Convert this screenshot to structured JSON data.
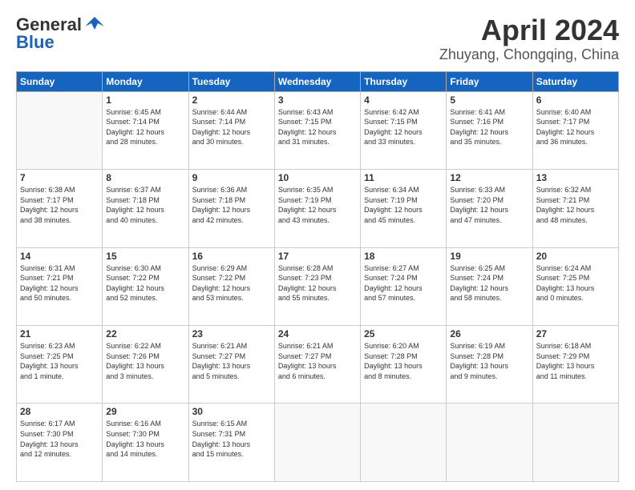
{
  "header": {
    "logo_general": "General",
    "logo_blue": "Blue",
    "title": "April 2024",
    "subtitle": "Zhuyang, Chongqing, China"
  },
  "calendar": {
    "days_of_week": [
      "Sunday",
      "Monday",
      "Tuesday",
      "Wednesday",
      "Thursday",
      "Friday",
      "Saturday"
    ],
    "weeks": [
      [
        {
          "num": "",
          "info": ""
        },
        {
          "num": "1",
          "info": "Sunrise: 6:45 AM\nSunset: 7:14 PM\nDaylight: 12 hours\nand 28 minutes."
        },
        {
          "num": "2",
          "info": "Sunrise: 6:44 AM\nSunset: 7:14 PM\nDaylight: 12 hours\nand 30 minutes."
        },
        {
          "num": "3",
          "info": "Sunrise: 6:43 AM\nSunset: 7:15 PM\nDaylight: 12 hours\nand 31 minutes."
        },
        {
          "num": "4",
          "info": "Sunrise: 6:42 AM\nSunset: 7:15 PM\nDaylight: 12 hours\nand 33 minutes."
        },
        {
          "num": "5",
          "info": "Sunrise: 6:41 AM\nSunset: 7:16 PM\nDaylight: 12 hours\nand 35 minutes."
        },
        {
          "num": "6",
          "info": "Sunrise: 6:40 AM\nSunset: 7:17 PM\nDaylight: 12 hours\nand 36 minutes."
        }
      ],
      [
        {
          "num": "7",
          "info": "Sunrise: 6:38 AM\nSunset: 7:17 PM\nDaylight: 12 hours\nand 38 minutes."
        },
        {
          "num": "8",
          "info": "Sunrise: 6:37 AM\nSunset: 7:18 PM\nDaylight: 12 hours\nand 40 minutes."
        },
        {
          "num": "9",
          "info": "Sunrise: 6:36 AM\nSunset: 7:18 PM\nDaylight: 12 hours\nand 42 minutes."
        },
        {
          "num": "10",
          "info": "Sunrise: 6:35 AM\nSunset: 7:19 PM\nDaylight: 12 hours\nand 43 minutes."
        },
        {
          "num": "11",
          "info": "Sunrise: 6:34 AM\nSunset: 7:19 PM\nDaylight: 12 hours\nand 45 minutes."
        },
        {
          "num": "12",
          "info": "Sunrise: 6:33 AM\nSunset: 7:20 PM\nDaylight: 12 hours\nand 47 minutes."
        },
        {
          "num": "13",
          "info": "Sunrise: 6:32 AM\nSunset: 7:21 PM\nDaylight: 12 hours\nand 48 minutes."
        }
      ],
      [
        {
          "num": "14",
          "info": "Sunrise: 6:31 AM\nSunset: 7:21 PM\nDaylight: 12 hours\nand 50 minutes."
        },
        {
          "num": "15",
          "info": "Sunrise: 6:30 AM\nSunset: 7:22 PM\nDaylight: 12 hours\nand 52 minutes."
        },
        {
          "num": "16",
          "info": "Sunrise: 6:29 AM\nSunset: 7:22 PM\nDaylight: 12 hours\nand 53 minutes."
        },
        {
          "num": "17",
          "info": "Sunrise: 6:28 AM\nSunset: 7:23 PM\nDaylight: 12 hours\nand 55 minutes."
        },
        {
          "num": "18",
          "info": "Sunrise: 6:27 AM\nSunset: 7:24 PM\nDaylight: 12 hours\nand 57 minutes."
        },
        {
          "num": "19",
          "info": "Sunrise: 6:25 AM\nSunset: 7:24 PM\nDaylight: 12 hours\nand 58 minutes."
        },
        {
          "num": "20",
          "info": "Sunrise: 6:24 AM\nSunset: 7:25 PM\nDaylight: 13 hours\nand 0 minutes."
        }
      ],
      [
        {
          "num": "21",
          "info": "Sunrise: 6:23 AM\nSunset: 7:25 PM\nDaylight: 13 hours\nand 1 minute."
        },
        {
          "num": "22",
          "info": "Sunrise: 6:22 AM\nSunset: 7:26 PM\nDaylight: 13 hours\nand 3 minutes."
        },
        {
          "num": "23",
          "info": "Sunrise: 6:21 AM\nSunset: 7:27 PM\nDaylight: 13 hours\nand 5 minutes."
        },
        {
          "num": "24",
          "info": "Sunrise: 6:21 AM\nSunset: 7:27 PM\nDaylight: 13 hours\nand 6 minutes."
        },
        {
          "num": "25",
          "info": "Sunrise: 6:20 AM\nSunset: 7:28 PM\nDaylight: 13 hours\nand 8 minutes."
        },
        {
          "num": "26",
          "info": "Sunrise: 6:19 AM\nSunset: 7:28 PM\nDaylight: 13 hours\nand 9 minutes."
        },
        {
          "num": "27",
          "info": "Sunrise: 6:18 AM\nSunset: 7:29 PM\nDaylight: 13 hours\nand 11 minutes."
        }
      ],
      [
        {
          "num": "28",
          "info": "Sunrise: 6:17 AM\nSunset: 7:30 PM\nDaylight: 13 hours\nand 12 minutes."
        },
        {
          "num": "29",
          "info": "Sunrise: 6:16 AM\nSunset: 7:30 PM\nDaylight: 13 hours\nand 14 minutes."
        },
        {
          "num": "30",
          "info": "Sunrise: 6:15 AM\nSunset: 7:31 PM\nDaylight: 13 hours\nand 15 minutes."
        },
        {
          "num": "",
          "info": ""
        },
        {
          "num": "",
          "info": ""
        },
        {
          "num": "",
          "info": ""
        },
        {
          "num": "",
          "info": ""
        }
      ]
    ]
  }
}
